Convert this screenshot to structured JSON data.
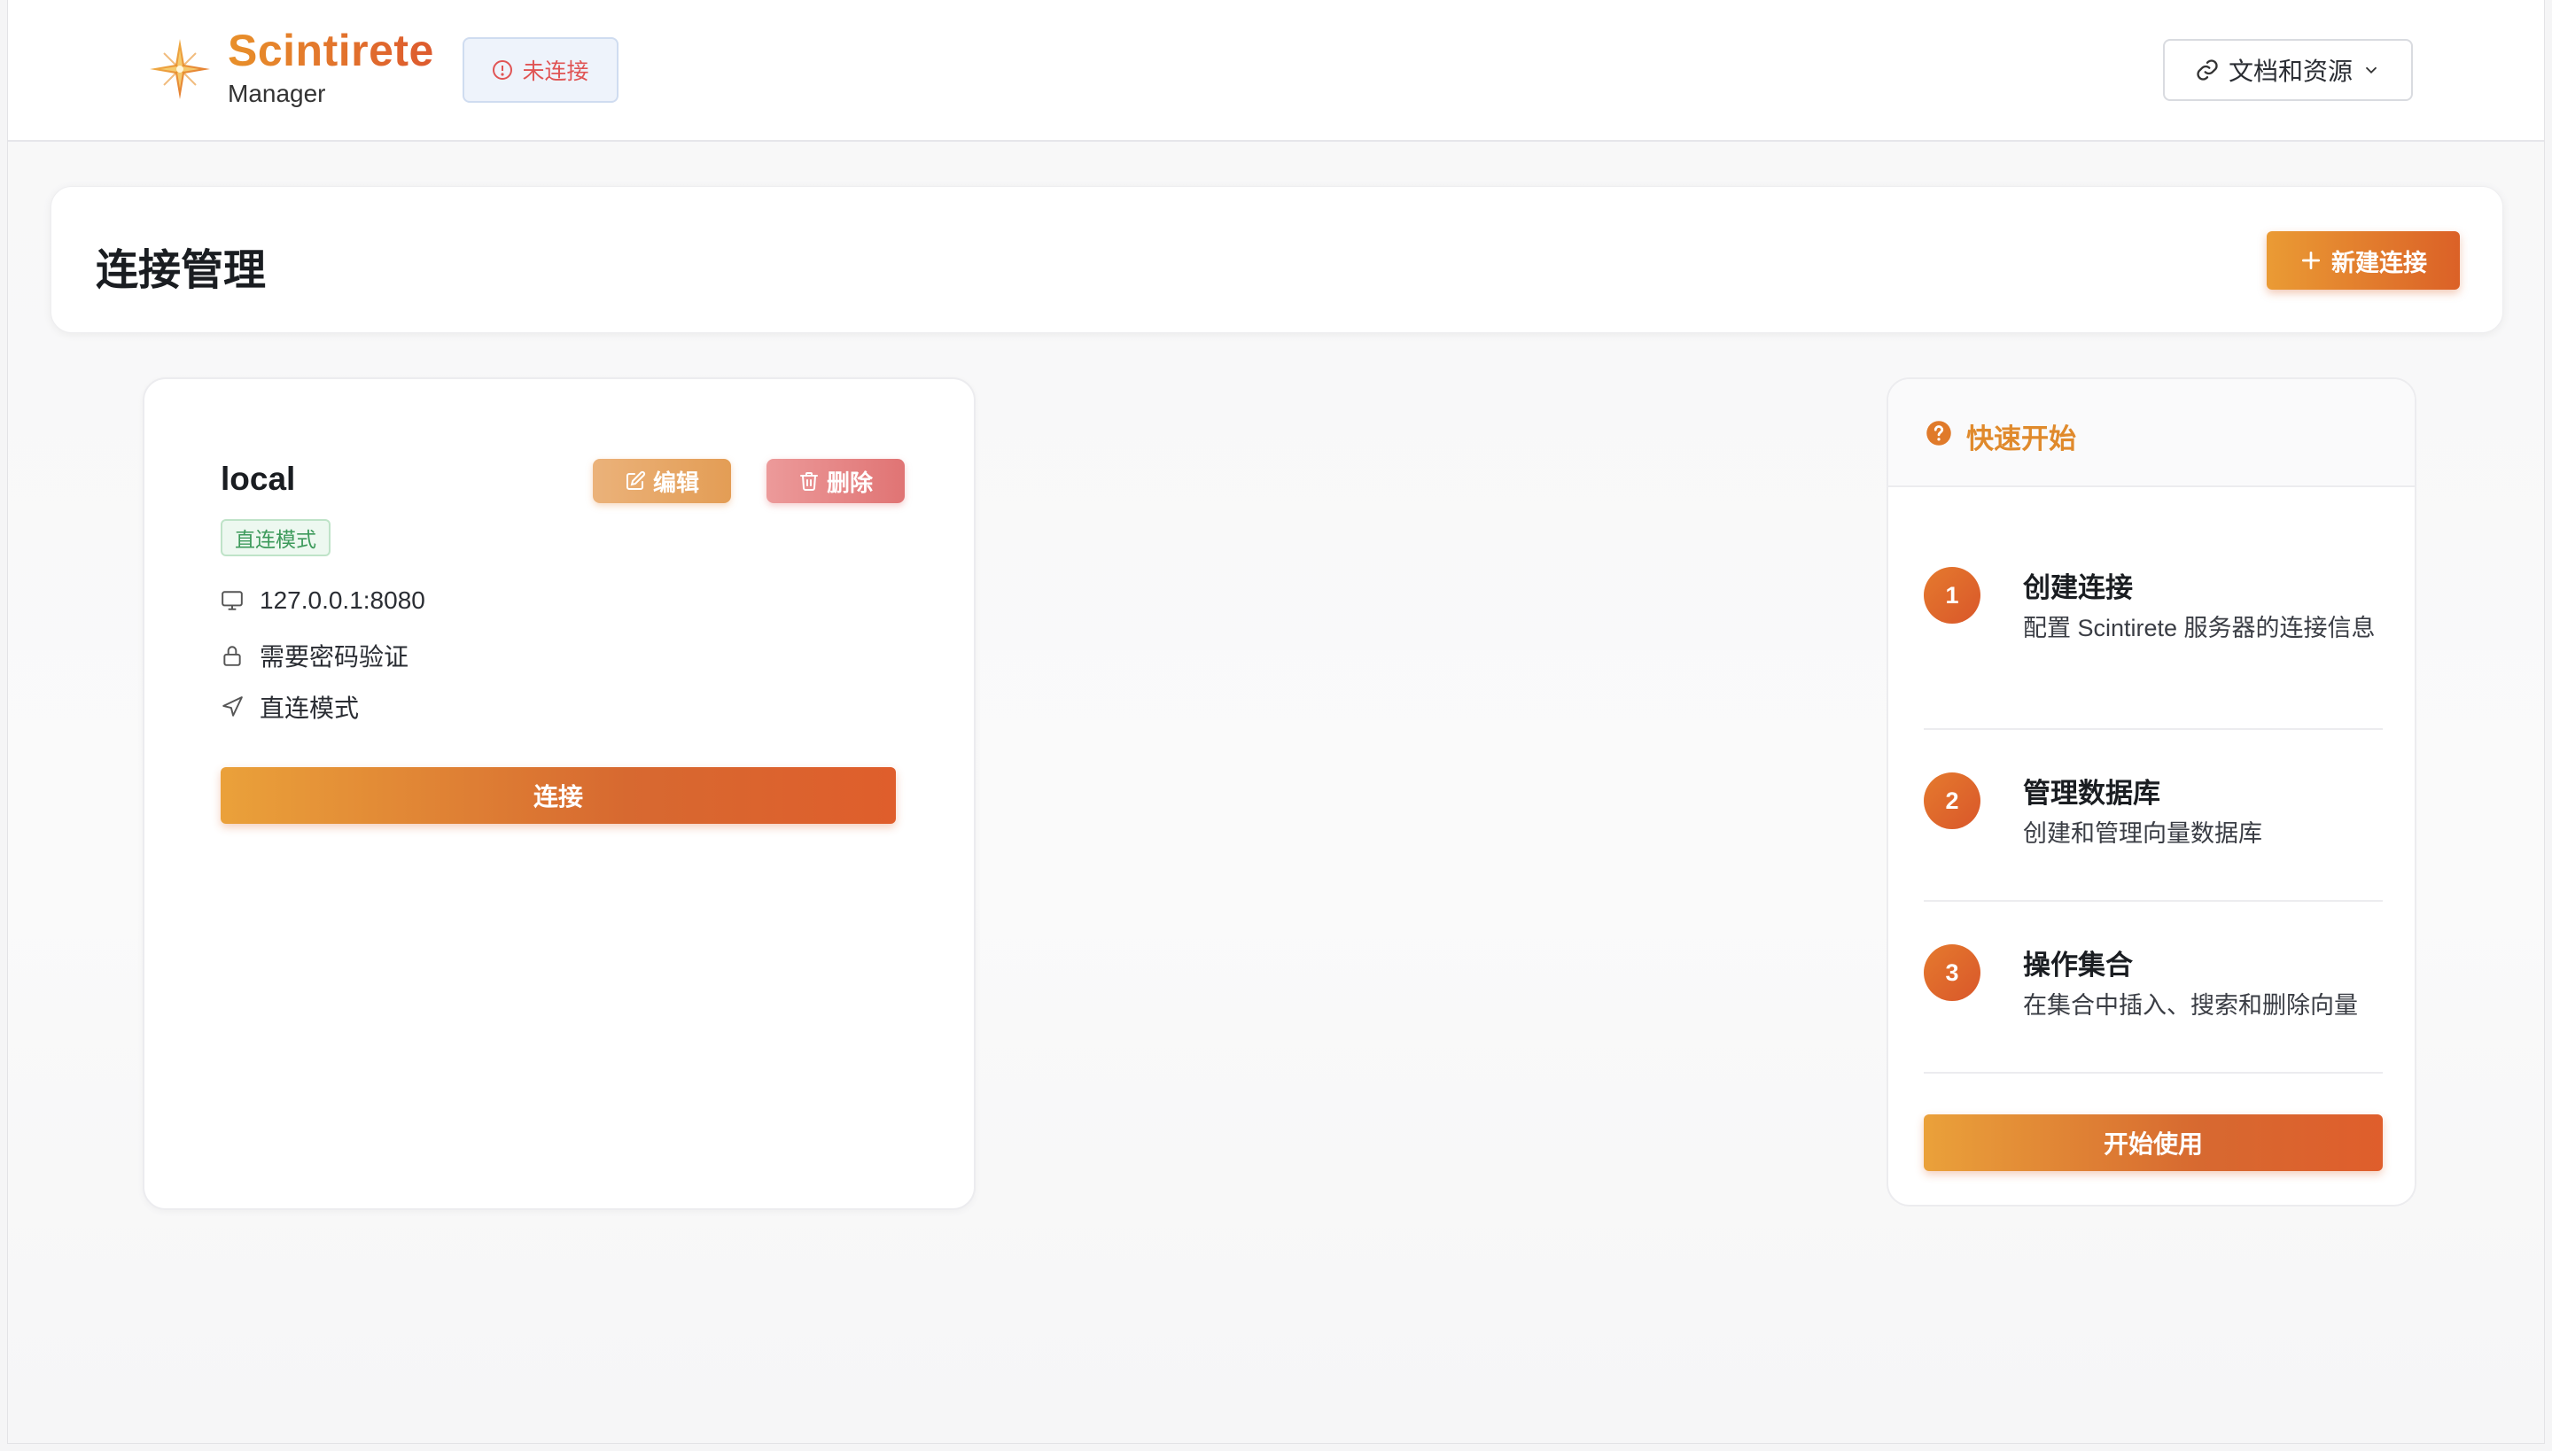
{
  "header": {
    "brand_name": "Scintirete",
    "brand_sub": "Manager",
    "status": "未连接",
    "docs_label": "文档和资源"
  },
  "page": {
    "title": "连接管理",
    "new_connection_label": "新建连接"
  },
  "connection": {
    "name": "local",
    "edit_label": "编辑",
    "delete_label": "删除",
    "mode_tag": "直连模式",
    "address": "127.0.0.1:8080",
    "auth": "需要密码验证",
    "mode": "直连模式",
    "connect_label": "连接"
  },
  "quick_start": {
    "title": "快速开始",
    "steps": [
      {
        "num": "1",
        "title": "创建连接",
        "desc": "配置 Scintirete 服务器的连接信息"
      },
      {
        "num": "2",
        "title": "管理数据库",
        "desc": "创建和管理向量数据库"
      },
      {
        "num": "3",
        "title": "操作集合",
        "desc": "在集合中插入、搜索和删除向量"
      }
    ],
    "start_label": "开始使用"
  },
  "colors": {
    "accent_start": "#ea9b34",
    "accent_end": "#db6127",
    "danger": "#e05454",
    "success": "#3d9a5b"
  },
  "icons": [
    "sparkle-logo-icon",
    "alert-circle-icon",
    "link-icon",
    "chevron-down-icon",
    "plus-icon",
    "edit-icon",
    "trash-icon",
    "monitor-icon",
    "lock-icon",
    "navigation-icon",
    "help-circle-icon"
  ]
}
